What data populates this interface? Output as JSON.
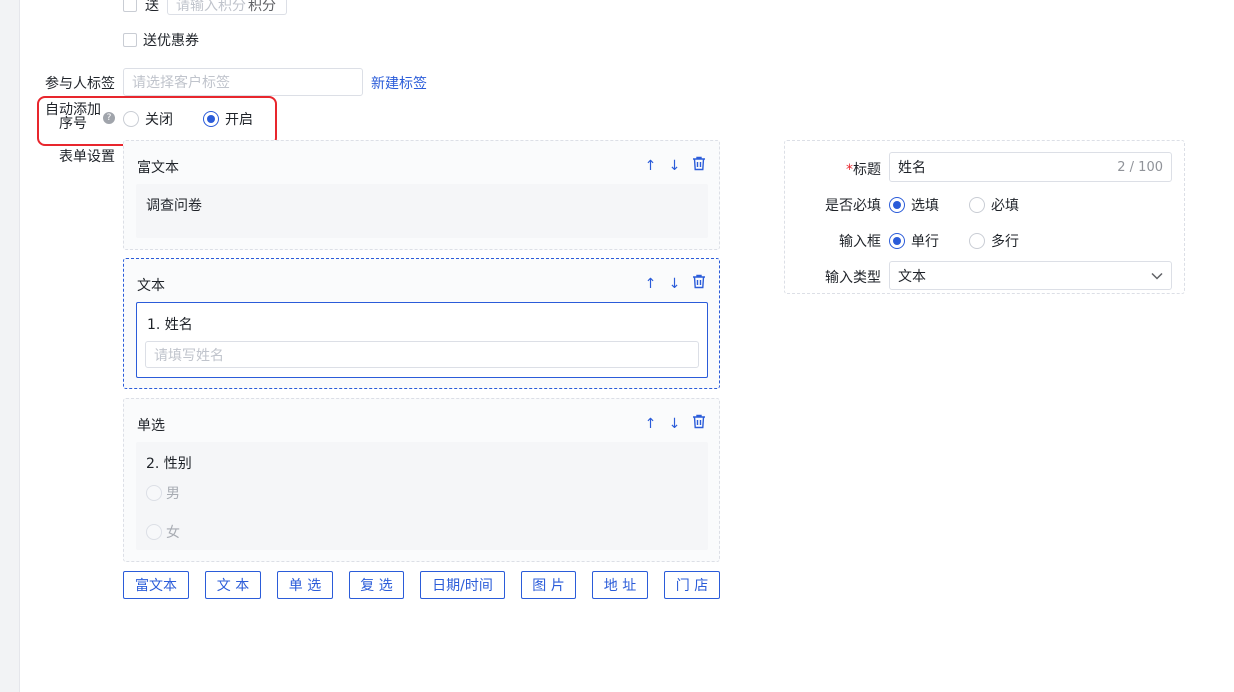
{
  "reward": {
    "points_label": "送",
    "points_placeholder": "请输入积分",
    "points_suffix": "积分",
    "coupon_label": "送优惠券"
  },
  "tags": {
    "label": "参与人标签",
    "placeholder": "请选择客户标签",
    "new_link": "新建标签"
  },
  "auto_number": {
    "label_line1": "自动添加",
    "label_line2": "序号",
    "help_icon": "help-circle-icon",
    "options": [
      "关闭",
      "开启"
    ],
    "selected": "开启"
  },
  "form_settings": {
    "label": "表单设置",
    "blocks": [
      {
        "type": "富文本",
        "content": "调查问卷"
      },
      {
        "type": "文本",
        "question": "1. 姓名",
        "input_placeholder": "请填写姓名"
      },
      {
        "type": "单选",
        "question": "2. 性别",
        "options": [
          "男",
          "女"
        ]
      }
    ],
    "tool_icons": [
      "arrow-up-icon",
      "arrow-down-icon",
      "trash-icon"
    ],
    "add_buttons": [
      "富文本",
      "文 本",
      "单 选",
      "复 选",
      "日期/时间",
      "图 片",
      "地 址",
      "门 店"
    ]
  },
  "properties": {
    "title_label": "标题",
    "title_value": "姓名",
    "title_count": "2 / 100",
    "required_label": "是否必填",
    "required_options": [
      "选填",
      "必填"
    ],
    "required_selected": "选填",
    "input_label": "输入框",
    "input_options": [
      "单行",
      "多行"
    ],
    "input_selected": "单行",
    "type_label": "输入类型",
    "type_value": "文本"
  },
  "colors": {
    "accent": "#2b5cd9",
    "highlight": "#e8262d"
  }
}
